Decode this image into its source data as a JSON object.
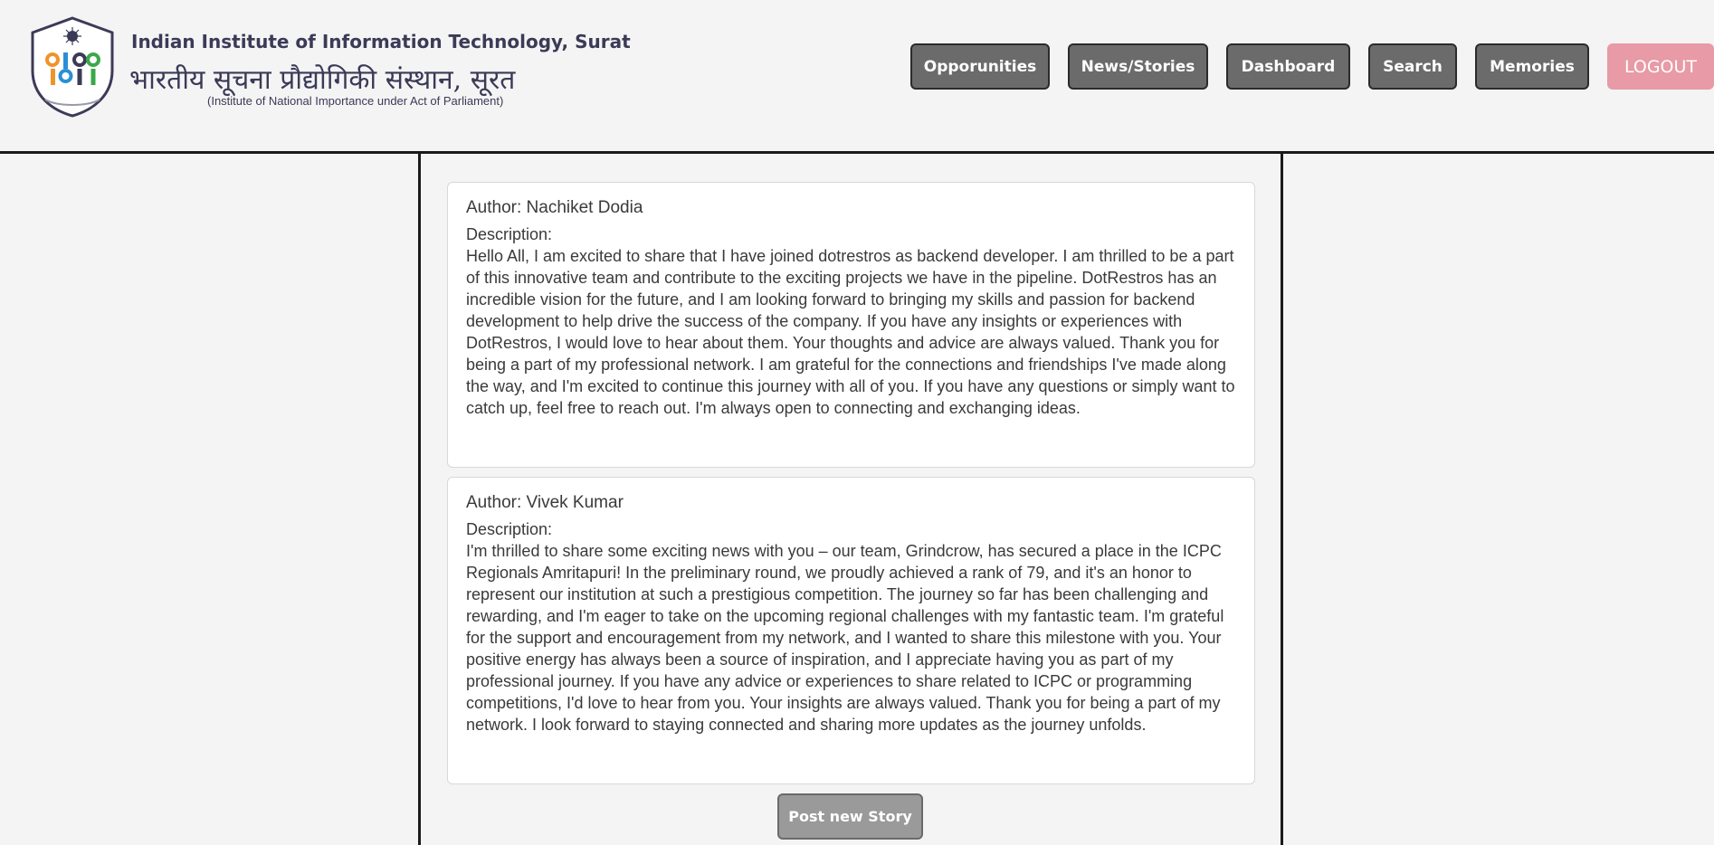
{
  "header": {
    "institute_name": "Indian Institute of Information Technology, Surat",
    "institute_name_hindi": "भारतीय सूचना प्रौद्योगिकी संस्थान, सूरत",
    "institute_subtitle": "(Institute of National Importance under Act of Parliament)",
    "logo": {
      "icon": "iiit-surat-logo",
      "text": "IIIT",
      "colors": [
        "#f0932b",
        "#2b8fd6",
        "#3aa84b",
        "#3b3a57"
      ]
    }
  },
  "nav": {
    "opportunities": "Opporunities",
    "news_stories": "News/Stories",
    "dashboard": "Dashboard",
    "search": "Search",
    "memories": "Memories",
    "logout": "LOGOUT"
  },
  "stories": [
    {
      "author": "Author: Nachiket Dodia",
      "description_label": "Description:",
      "description": "Hello All, I am excited to share that I have joined dotrestros as backend developer. I am thrilled to be a part of this innovative team and contribute to the exciting projects we have in the pipeline. DotRestros has an incredible vision for the future, and I am looking forward to bringing my skills and passion for backend development to help drive the success of the company. If you have any insights or experiences with DotRestros, I would love to hear about them. Your thoughts and advice are always valued. Thank you for being a part of my professional network. I am grateful for the connections and friendships I've made along the way, and I'm excited to continue this journey with all of you. If you have any questions or simply want to catch up, feel free to reach out. I'm always open to connecting and exchanging ideas."
    },
    {
      "author": "Author: Vivek Kumar",
      "description_label": "Description:",
      "description": "I'm thrilled to share some exciting news with you – our team, Grindcrow, has secured a place in the ICPC Regionals Amritapuri! In the preliminary round, we proudly achieved a rank of 79, and it's an honor to represent our institution at such a prestigious competition. The journey so far has been challenging and rewarding, and I'm eager to take on the upcoming regional challenges with my fantastic team. I'm grateful for the support and encouragement from my network, and I wanted to share this milestone with you. Your positive energy has always been a source of inspiration, and I appreciate having you as part of my professional journey. If you have any advice or experiences to share related to ICPC or programming competitions, I'd love to hear from you. Your insights are always valued. Thank you for being a part of my network. I look forward to staying connected and sharing more updates as the journey unfolds."
    }
  ],
  "actions": {
    "post_new_story": "Post new Story"
  },
  "colors": {
    "nav_button": "#6b6b6b",
    "logout_button": "#e89aa6",
    "post_button": "#9a9a9a",
    "institute_text": "#3b3a57"
  }
}
